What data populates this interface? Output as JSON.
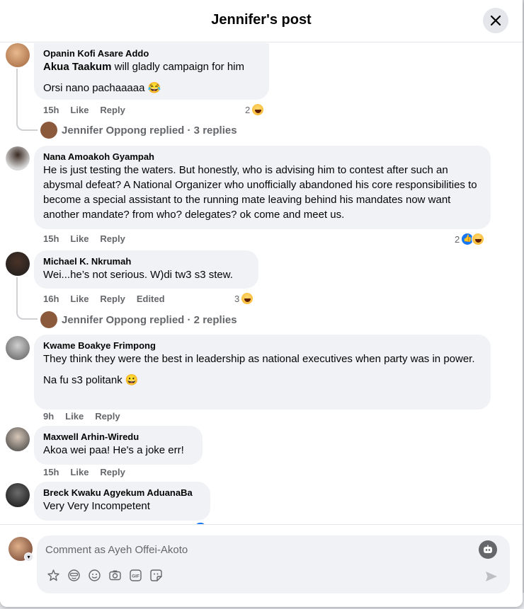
{
  "header": {
    "title": "Jennifer's post"
  },
  "comments": [
    {
      "author": "Opanin Kofi Asare Addo",
      "mention": "Akua Taakum",
      "text1_rest": " will gladly campaign for him",
      "text2": "Orsi nano pachaaaaa 😂",
      "time": "15h",
      "like": "Like",
      "reply": "Reply",
      "reaction_count": "2"
    },
    {
      "author": "Nana Amoakoh Gyampah",
      "text": "He is just testing the waters. But honestly, who is advising him to contest after such an abysmal defeat? A National Organizer who unofficially abandoned his core responsibilities to become a special assistant to the running mate leaving behind his mandates now want another mandate? from who? delegates? ok come and meet us.",
      "time": "15h",
      "like": "Like",
      "reply": "Reply",
      "reaction_count": "2"
    },
    {
      "author": "Michael K. Nkrumah",
      "text": "Wei...he’s not serious. W)di tw3 s3 stew.",
      "time": "16h",
      "like": "Like",
      "reply": "Reply",
      "edited": "Edited",
      "reaction_count": "3"
    },
    {
      "author": "Kwame Boakye Frimpong",
      "text": "They think they were the best in leadership as national executives when party was in power.",
      "text2": "Na fu s3 politank 😀",
      "time": "9h",
      "like": "Like",
      "reply": "Reply"
    },
    {
      "author": "Maxwell Arhin-Wiredu",
      "text": "Akoa wei paa! He's a joke err!",
      "time": "15h",
      "like": "Like",
      "reply": "Reply"
    },
    {
      "author": "Breck Kwaku Agyekum AduanaBa",
      "text": "Very Very Incompetent"
    }
  ],
  "replies": [
    {
      "label": "Jennifer Oppong replied · 3 replies"
    },
    {
      "label": "Jennifer Oppong replied · 2 replies"
    }
  ],
  "composer": {
    "placeholder": "Comment as Ayeh Offei-Akoto",
    "tools": [
      "avatar-sticker-icon",
      "emoji-face-icon",
      "smiley-icon",
      "camera-icon",
      "gif-icon",
      "sticker-icon"
    ]
  },
  "colors": {
    "bubble": "#f0f2f5",
    "meta_text": "#65676b",
    "primary_text": "#050505",
    "like_blue": "#1877f2"
  }
}
